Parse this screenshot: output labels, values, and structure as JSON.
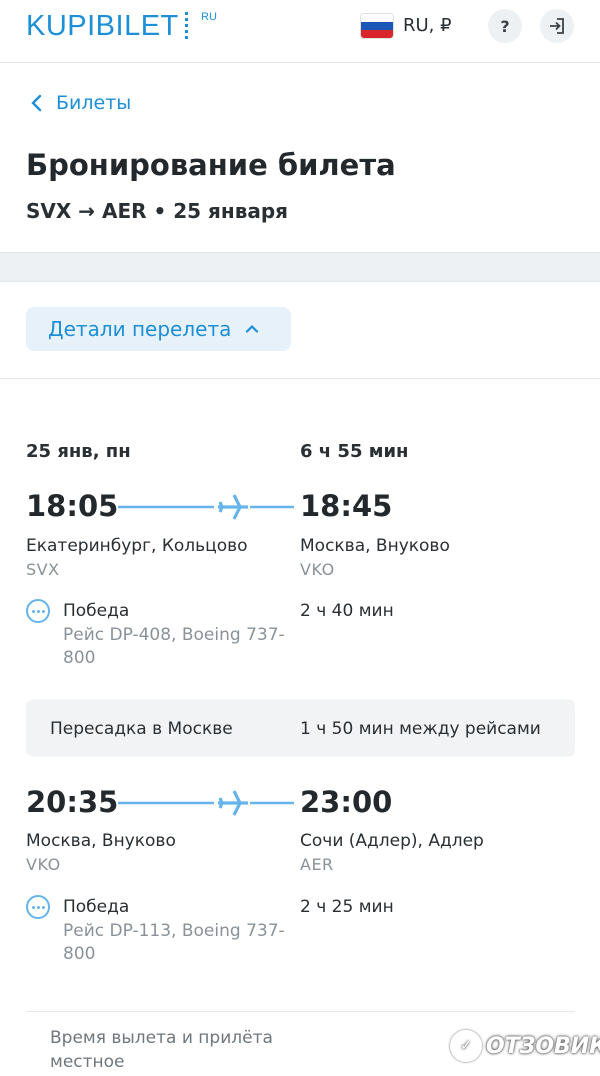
{
  "header": {
    "logo": "KUPIBILET",
    "logo_suffix": "RU",
    "locale": "RU, ₽",
    "help": "?",
    "brand_color": "#1c8fd6"
  },
  "nav": {
    "back_label": "Билеты"
  },
  "page": {
    "title": "Бронирование билета",
    "route": "SVX → AER • 25 января"
  },
  "details_toggle": {
    "label": "Детали перелета"
  },
  "trip": {
    "date": "25 янв, пн",
    "total_duration": "6 ч 55 мин"
  },
  "segments": [
    {
      "dep_time": "18:05",
      "arr_time": "18:45",
      "dep_city": "Екатеринбург, Кольцово",
      "dep_code": "SVX",
      "arr_city": "Москва, Внуково",
      "arr_code": "VKO",
      "airline": "Победа",
      "flight": "Рейс DP-408, Boeing 737-800",
      "duration": "2 ч 40 мин"
    },
    {
      "dep_time": "20:35",
      "arr_time": "23:00",
      "dep_city": "Москва, Внуково",
      "dep_code": "VKO",
      "arr_city": "Сочи (Адлер), Адлер",
      "arr_code": "AER",
      "airline": "Победа",
      "flight": "Рейс DP-113, Boeing 737-800",
      "duration": "2 ч 25 мин"
    }
  ],
  "transfer": {
    "label": "Пересадка в Москве",
    "duration": "1 ч 50 мин между рейсами"
  },
  "note": "Время вылета и прилёта местное",
  "watermark": "ОТЗОВИК"
}
